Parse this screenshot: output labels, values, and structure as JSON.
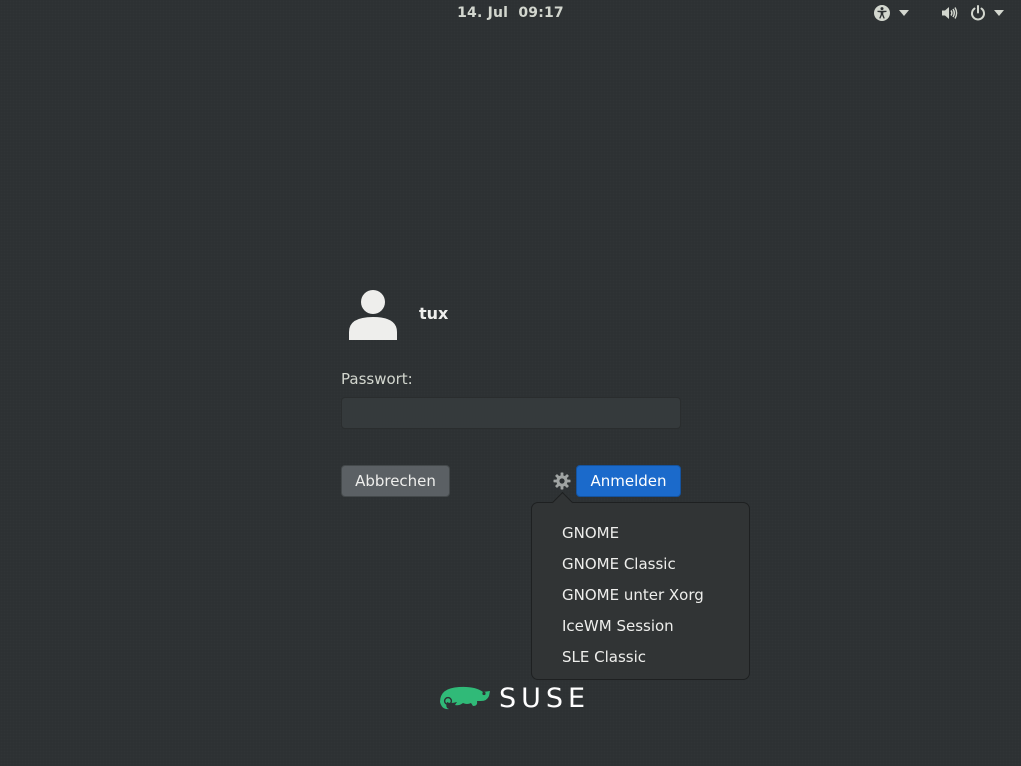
{
  "topbar": {
    "date": "14. Jul",
    "time": "09:17",
    "icons": {
      "accessibility": "accessibility-icon",
      "volume": "volume-icon",
      "power": "power-icon",
      "dropdown": "chevron-down-icon"
    }
  },
  "login": {
    "username": "tux",
    "password_label": "Passwort:",
    "password_value": "",
    "cancel_label": "Abbrechen",
    "login_label": "Anmelden",
    "session_icon": "gear-icon"
  },
  "sessions": [
    {
      "label": "GNOME"
    },
    {
      "label": "GNOME Classic"
    },
    {
      "label": "GNOME unter Xorg"
    },
    {
      "label": "IceWM Session"
    },
    {
      "label": "SLE Classic"
    }
  ],
  "branding": {
    "logo_text": "SUSE",
    "logo_color": "#30ba78"
  },
  "colors": {
    "background": "#2d3133",
    "accent": "#1b6acb",
    "cancel_button": "#5b6064",
    "popover": "#313435"
  }
}
